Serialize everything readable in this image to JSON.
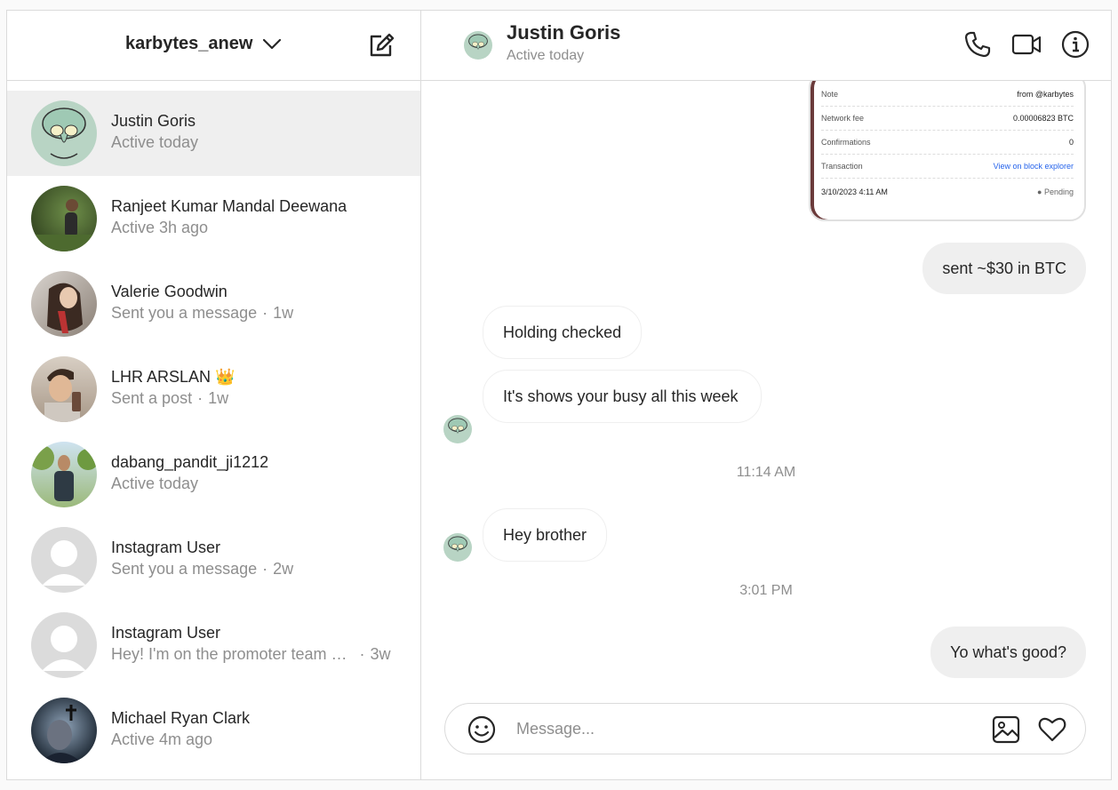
{
  "account": {
    "username": "karbytes_anew"
  },
  "threads": [
    {
      "name": "Justin Goris",
      "status": "Active today",
      "time": "",
      "avatar": "squidward",
      "active": true
    },
    {
      "name": "Ranjeet Kumar Mandal Deewana",
      "status": "Active 3h ago",
      "time": "",
      "avatar": "photo-green"
    },
    {
      "name": "Valerie Goodwin",
      "status": "Sent you a message",
      "time": "1w",
      "avatar": "photo-portrait"
    },
    {
      "name": "LHR ARSLAN 👑",
      "status": "Sent a post",
      "time": "1w",
      "avatar": "photo-selfie"
    },
    {
      "name": "dabang_pandit_ji1212",
      "status": "Active today",
      "time": "",
      "avatar": "photo-outdoor"
    },
    {
      "name": "Instagram User",
      "status": "Sent you a message",
      "time": "2w",
      "avatar": "default"
    },
    {
      "name": "Instagram User",
      "status": "Hey! I'm on the promoter team …",
      "time": "3w",
      "avatar": "default"
    },
    {
      "name": "Michael Ryan Clark",
      "status": "Active 4m ago",
      "time": "",
      "avatar": "photo-dark"
    }
  ],
  "chat": {
    "name": "Justin Goris",
    "status": "Active today",
    "receipt": {
      "rows": [
        {
          "label": "Note",
          "value": "from @karbytes"
        },
        {
          "label": "Network fee",
          "value": "0.00006823 BTC"
        },
        {
          "label": "Confirmations",
          "value": "0"
        },
        {
          "label": "Transaction",
          "value": "View on block explorer"
        },
        {
          "label": "3/10/2023 4:11 AM",
          "value": "● Pending"
        }
      ]
    },
    "messages": [
      {
        "dir": "out",
        "text": "sent ~$30 in BTC"
      },
      {
        "dir": "in",
        "text": "Holding checked"
      },
      {
        "dir": "in",
        "text": "It's shows your busy all this week"
      },
      {
        "dir": "in",
        "text": "Hey brother"
      },
      {
        "dir": "out",
        "text": "Yo what's good?"
      }
    ],
    "timestamps": [
      "11:14 AM",
      "3:01 PM"
    ]
  },
  "composer": {
    "placeholder": "Message..."
  },
  "colors": {
    "border": "#dbdbdb",
    "bubble_out": "#efefef",
    "muted": "#8e8e8e",
    "active_row": "#efefef"
  }
}
